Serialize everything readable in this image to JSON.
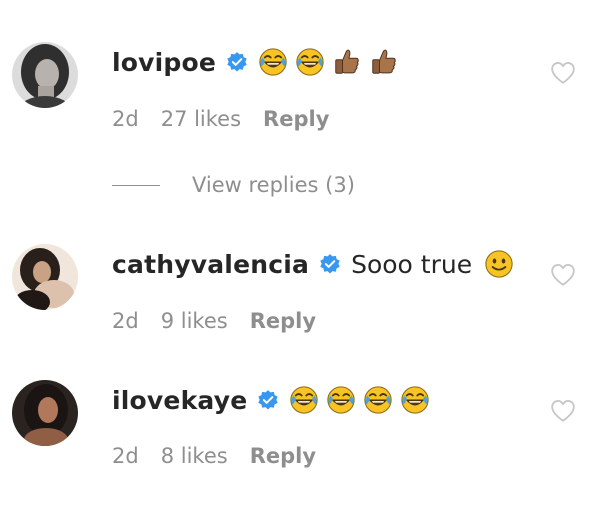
{
  "comments": [
    {
      "username": "lovipoe",
      "verified": true,
      "text": "",
      "emojis": [
        "joy-emoji",
        "joy-emoji",
        "thumbs-up-emoji",
        "thumbs-up-emoji"
      ],
      "age": "2d",
      "likes": "27 likes",
      "reply_label": "Reply"
    },
    {
      "username": "cathyvalencia",
      "verified": true,
      "text": "Sooo true",
      "emojis": [
        "slight-smile-emoji"
      ],
      "age": "2d",
      "likes": "9 likes",
      "reply_label": "Reply"
    },
    {
      "username": "ilovekaye",
      "verified": true,
      "text": "",
      "emojis": [
        "joy-emoji",
        "joy-emoji",
        "joy-emoji",
        "joy-emoji"
      ],
      "age": "2d",
      "likes": "8 likes",
      "reply_label": "Reply"
    }
  ],
  "view_replies": {
    "label": "View replies (3)"
  },
  "colors": {
    "verified_blue": "#3897f0",
    "muted_text": "#8e8e8e",
    "primary_text": "#262626",
    "heart_outline": "#c7c7c7"
  },
  "icons": {
    "verified": "verified-badge-icon",
    "like": "heart-outline-icon"
  }
}
